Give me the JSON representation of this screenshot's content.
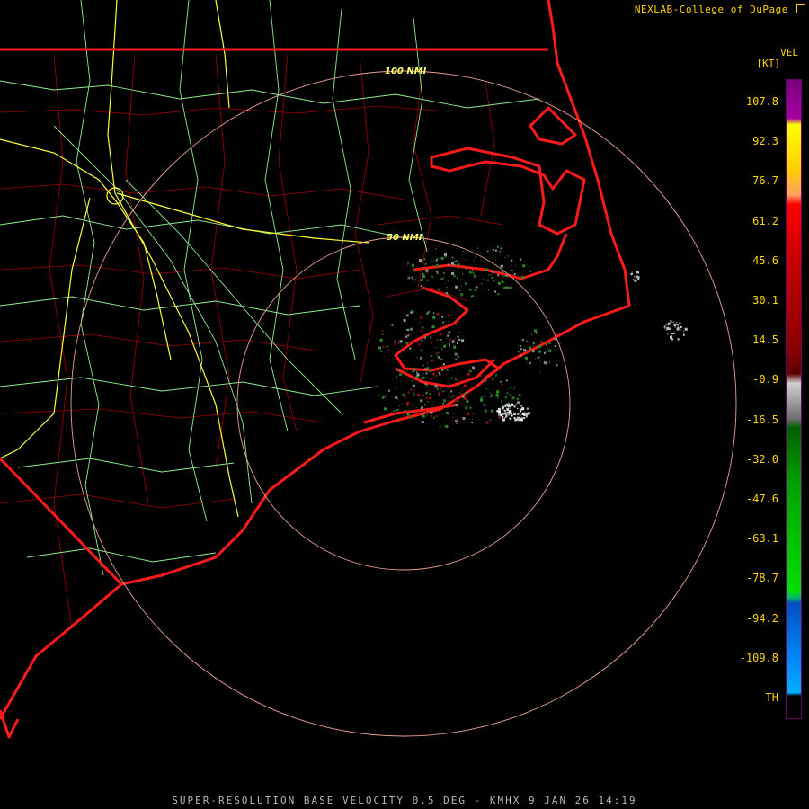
{
  "header": {
    "credit": "NEXLAB-College of DuPage",
    "credit_icon": "external-link-icon"
  },
  "footer": {
    "caption": "SUPER-RESOLUTION BASE VELOCITY 0.5 DEG - KMHX 9 JAN 26 14:19"
  },
  "legend": {
    "product": "VEL",
    "unit": "[KT]",
    "ticks": [
      "107.8",
      "92.3",
      "76.7",
      "61.2",
      "45.6",
      "30.1",
      "14.5",
      "-0.9",
      "-16.5",
      "-32.0",
      "-47.6",
      "-63.1",
      "-78.7",
      "-94.2",
      "-109.8",
      "TH"
    ],
    "palette": [
      "#7a007a",
      "#a300a3",
      "#ffff00",
      "#ffd000",
      "#ffa060",
      "#ff0000",
      "#c80000",
      "#8a0000",
      "#5a0000",
      "#d0d0d0",
      "#707070",
      "#006000",
      "#00a000",
      "#00e000",
      "#00c060",
      "#0050c0",
      "#0090ff",
      "#00b0ff"
    ]
  },
  "rings": [
    {
      "label": "100 NMI",
      "range_nmi": 100
    },
    {
      "label": "50 NMI",
      "range_nmi": 50
    }
  ],
  "colors": {
    "state_borders": "#ff1a1a",
    "county_borders": "#b00000",
    "highways": "#90ee90",
    "interstates": "#ffff33",
    "range_rings": "#e8a090"
  }
}
